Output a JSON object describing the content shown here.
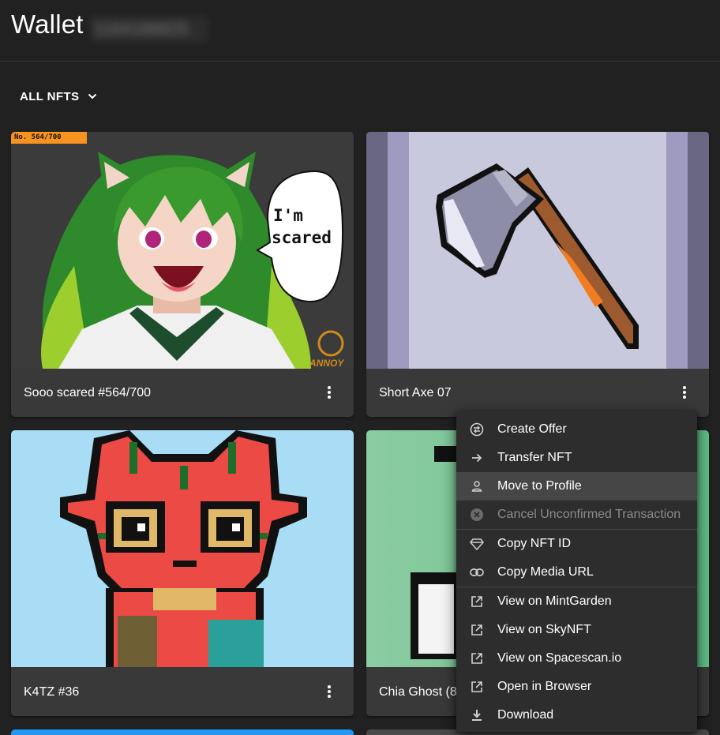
{
  "header": {
    "title": "Wallet",
    "wallet_id": "1164188825"
  },
  "filter": {
    "label": "ALL NFTS"
  },
  "cards": [
    {
      "caption": "Sooo scared #564/700",
      "badge": "No. 564/700",
      "speech": [
        "I'm",
        "scared"
      ],
      "watermark": "ANNOY"
    },
    {
      "caption": "Short Axe 07"
    },
    {
      "caption": "K4TZ #36"
    },
    {
      "caption": "Chia Ghost (8"
    }
  ],
  "menu": {
    "items": [
      {
        "label": "Create Offer",
        "icon": "swap-icon"
      },
      {
        "label": "Transfer NFT",
        "icon": "arrow-right-icon"
      },
      {
        "label": "Move to Profile",
        "icon": "person-icon"
      },
      {
        "label": "Cancel Unconfirmed Transaction",
        "icon": "cancel-circle-icon"
      },
      {
        "label": "Copy NFT ID",
        "icon": "diamond-icon"
      },
      {
        "label": "Copy Media URL",
        "icon": "link-icon"
      },
      {
        "label": "View on MintGarden",
        "icon": "external-link-icon"
      },
      {
        "label": "View on SkyNFT",
        "icon": "external-link-icon"
      },
      {
        "label": "View on Spacescan.io",
        "icon": "external-link-icon"
      },
      {
        "label": "Open in Browser",
        "icon": "external-link-icon"
      },
      {
        "label": "Download",
        "icon": "download-icon"
      }
    ]
  },
  "colors": {
    "background": "#212121",
    "card": "#393939",
    "menu": "#2d2d2d",
    "badge": "#f7931e",
    "k4tz_bg": "#a9dcf5",
    "ghost_bg": "#6cc28e"
  }
}
